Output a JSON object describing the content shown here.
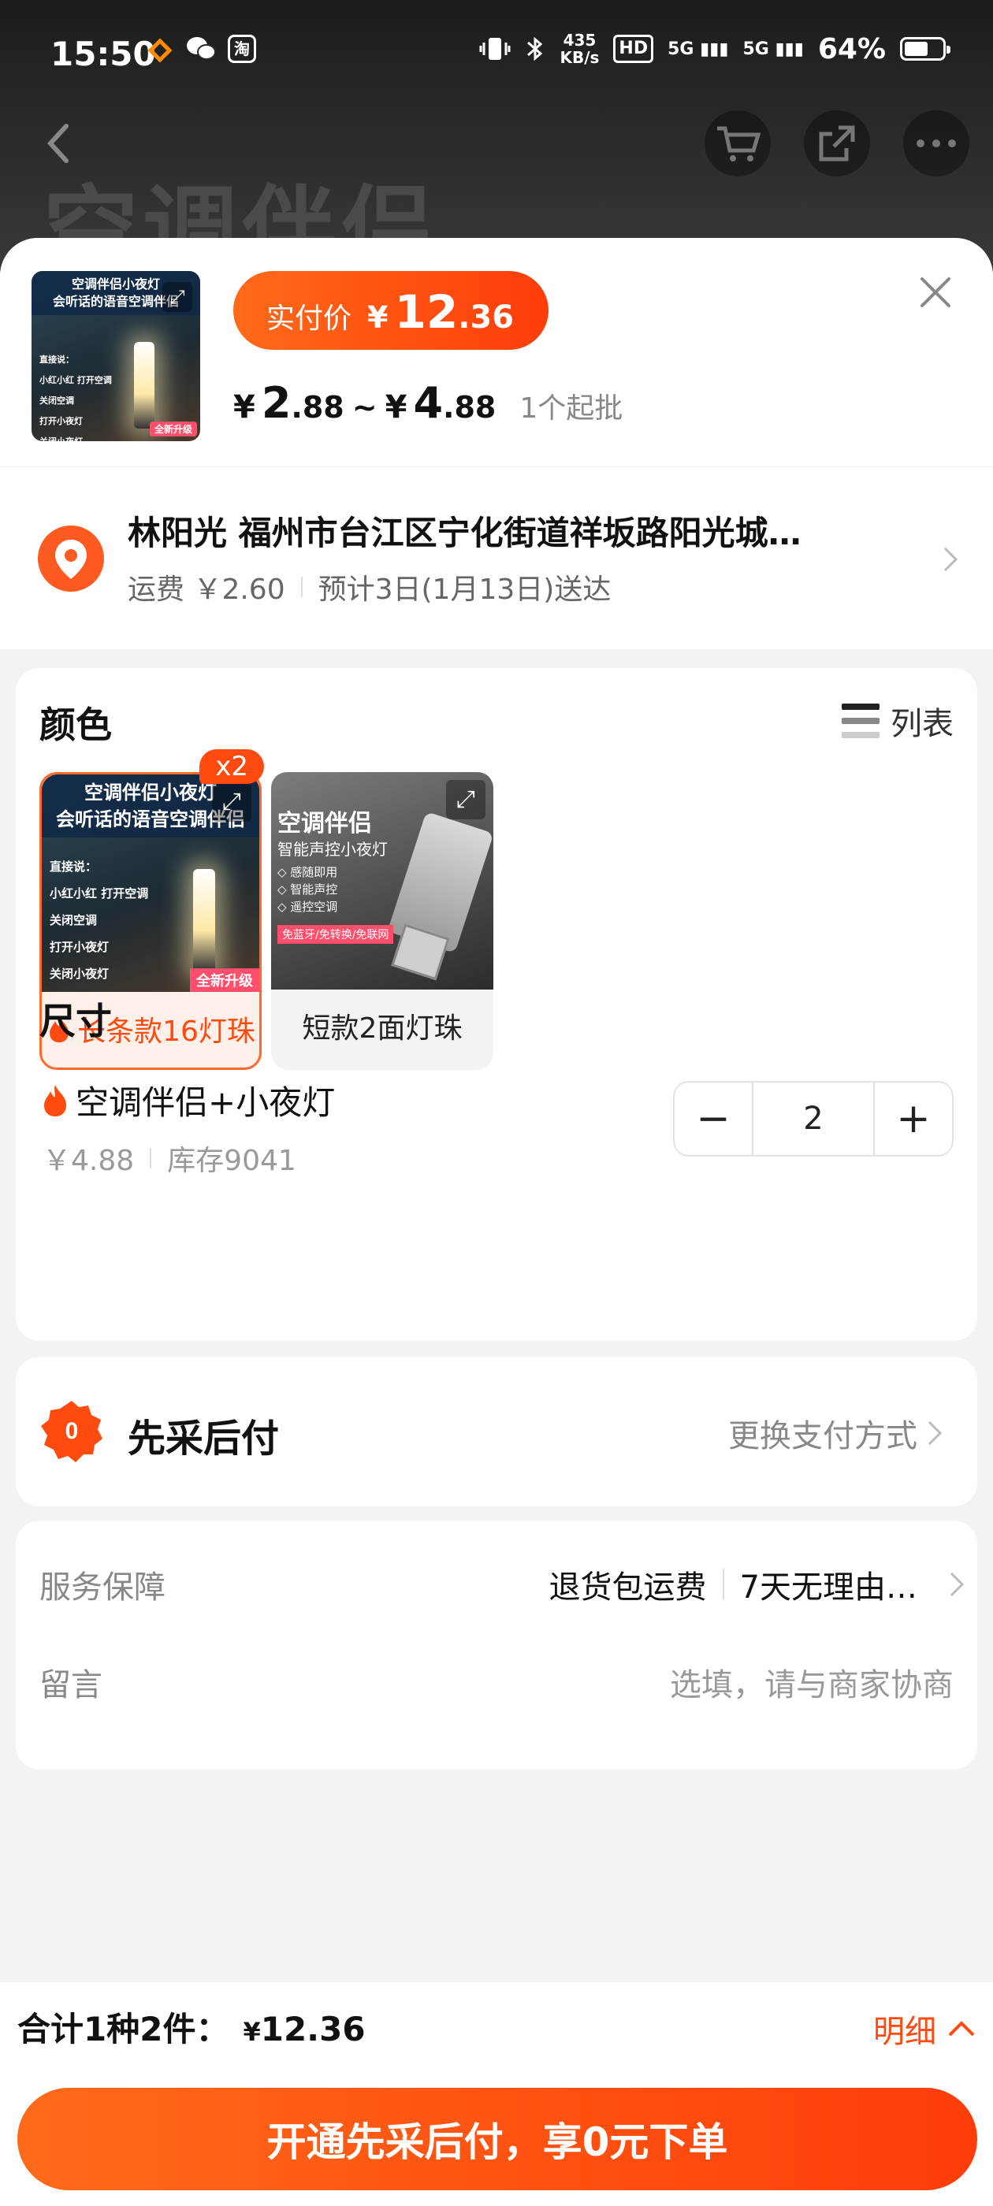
{
  "status_bar": {
    "time": "15:50",
    "app_icons": [
      "x",
      "wechat-icon",
      "淘"
    ],
    "speed_top": "435",
    "speed_bottom": "KB/s",
    "hd": "HD",
    "net1": "5G",
    "net2": "5G",
    "battery": "64%",
    "battery_level": 0.64
  },
  "background": {
    "title": "空调伴侣"
  },
  "header": {
    "thumb_title_line1": "空调伴侣小夜灯",
    "thumb_title_line2": "会听话的语音空调伴侣",
    "thumb_lines": [
      "直接说：",
      "小红小红  打开空调",
      "关闭空调",
      "打开小夜灯",
      "关闭小夜灯"
    ],
    "thumb_badge": "全新升级",
    "pay_label": "实付价",
    "pay_currency": "¥",
    "pay_int": "12",
    "pay_dec": ".36",
    "range_cur1": "¥",
    "range_low_int": "2",
    "range_low_dec": ".88",
    "range_tilde": "~",
    "range_cur2": "¥",
    "range_high_int": "4",
    "range_high_dec": ".88",
    "min_batch": "1个起批"
  },
  "address": {
    "title": "林阳光 福州市台江区宁化街道祥坂路阳光城…",
    "shipping": "运费 ￥2.60",
    "eta": "预计3日(1月13日)送达"
  },
  "color_section": {
    "title": "颜色",
    "list_toggle": "列表",
    "options": [
      {
        "label": "长条款16灯珠",
        "qty_badge": "x2",
        "img_title_line1": "空调伴侣小夜灯",
        "img_title_line2": "会听话的语音空调伴侣",
        "img_lines": [
          "直接说：",
          "小红小红  打开空调",
          "关闭空调",
          "打开小夜灯",
          "关闭小夜灯"
        ],
        "img_badge": "全新升级"
      },
      {
        "label": "短款2面灯珠",
        "img_title": "空调伴侣",
        "img_sub": "智能声控小夜灯",
        "img_lines": [
          "◇ 感随即用",
          "◇ 智能声控",
          "◇ 遥控空调"
        ],
        "img_tag": "免蓝牙/免转换/免联网"
      }
    ]
  },
  "size_section": {
    "title": "尺寸",
    "item_name": "空调伴侣+小夜灯",
    "price": "￥4.88",
    "stock": "库存9041",
    "quantity": "2",
    "minus": "−",
    "plus": "+"
  },
  "payment": {
    "title": "先采后付",
    "change": "更换支付方式"
  },
  "service": {
    "label": "服务保障",
    "value1": "退货包运费",
    "value2": "7天无理由…",
    "msg_label": "留言",
    "msg_placeholder": "选填，请与商家协商"
  },
  "footer": {
    "total_label": "合计1种2件：",
    "total_currency": "¥",
    "total_amount": "12.36",
    "detail": "明细",
    "cta": "开通先采后付，享0元下单"
  },
  "colors": {
    "accent": "#ff4a10",
    "accent_gradient_start": "#ff6a1a",
    "sheet_bg": "#f3f3f5"
  }
}
